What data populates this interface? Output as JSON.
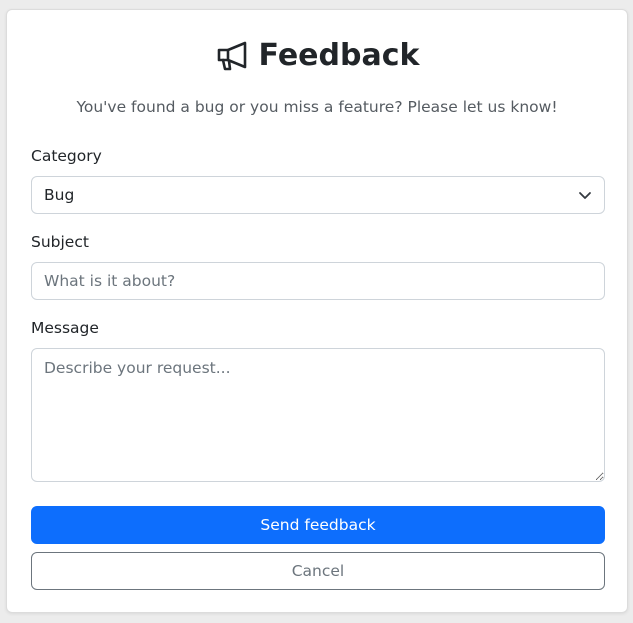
{
  "header": {
    "title": "Feedback",
    "icon": "megaphone-icon",
    "subtitle": "You've found a bug or you miss a feature? Please let us know!"
  },
  "form": {
    "category": {
      "label": "Category",
      "value": "Bug"
    },
    "subject": {
      "label": "Subject",
      "value": "",
      "placeholder": "What is it about?"
    },
    "message": {
      "label": "Message",
      "value": "",
      "placeholder": "Describe your request..."
    }
  },
  "actions": {
    "send_label": "Send feedback",
    "cancel_label": "Cancel"
  },
  "colors": {
    "primary": "#0d6efd",
    "secondary": "#6c757d",
    "border": "#ced4da"
  }
}
